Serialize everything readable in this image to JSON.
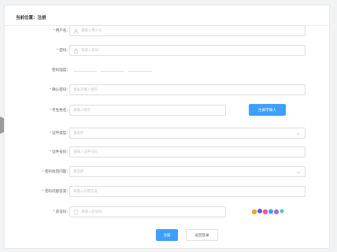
{
  "breadcrumb": "当前位置：注册",
  "form": {
    "username": {
      "label": "用户名：",
      "required": true,
      "placeholder": "请输入用户名"
    },
    "password": {
      "label": "密码：",
      "required": true,
      "placeholder": "请输入密码"
    },
    "strength": {
      "label": "密码强度："
    },
    "confirm": {
      "label": "确认密码：",
      "required": true,
      "placeholder": "请再次输入密码"
    },
    "student_name": {
      "label": "考生姓名：",
      "required": true,
      "placeholder": "请输入姓名"
    },
    "rare_char_button": "生僻字输入",
    "id_type": {
      "label": "证件类型：",
      "required": true,
      "placeholder": "请选择"
    },
    "id_number": {
      "label": "证件号码：",
      "required": true,
      "placeholder": "请输入证件号码"
    },
    "security_question": {
      "label": "密码找回问题：",
      "required": true,
      "placeholder": "请选择"
    },
    "security_answer": {
      "label": "密码问题答案：",
      "required": true,
      "placeholder": "请输入问题答案"
    },
    "captcha": {
      "label": "验证码：",
      "required": true,
      "placeholder": "请输入验证码"
    },
    "submit": "注册",
    "back": "返回登录"
  },
  "colors": {
    "primary": "#409eff",
    "required": "#f56c6c",
    "border": "#dcdfe6"
  }
}
